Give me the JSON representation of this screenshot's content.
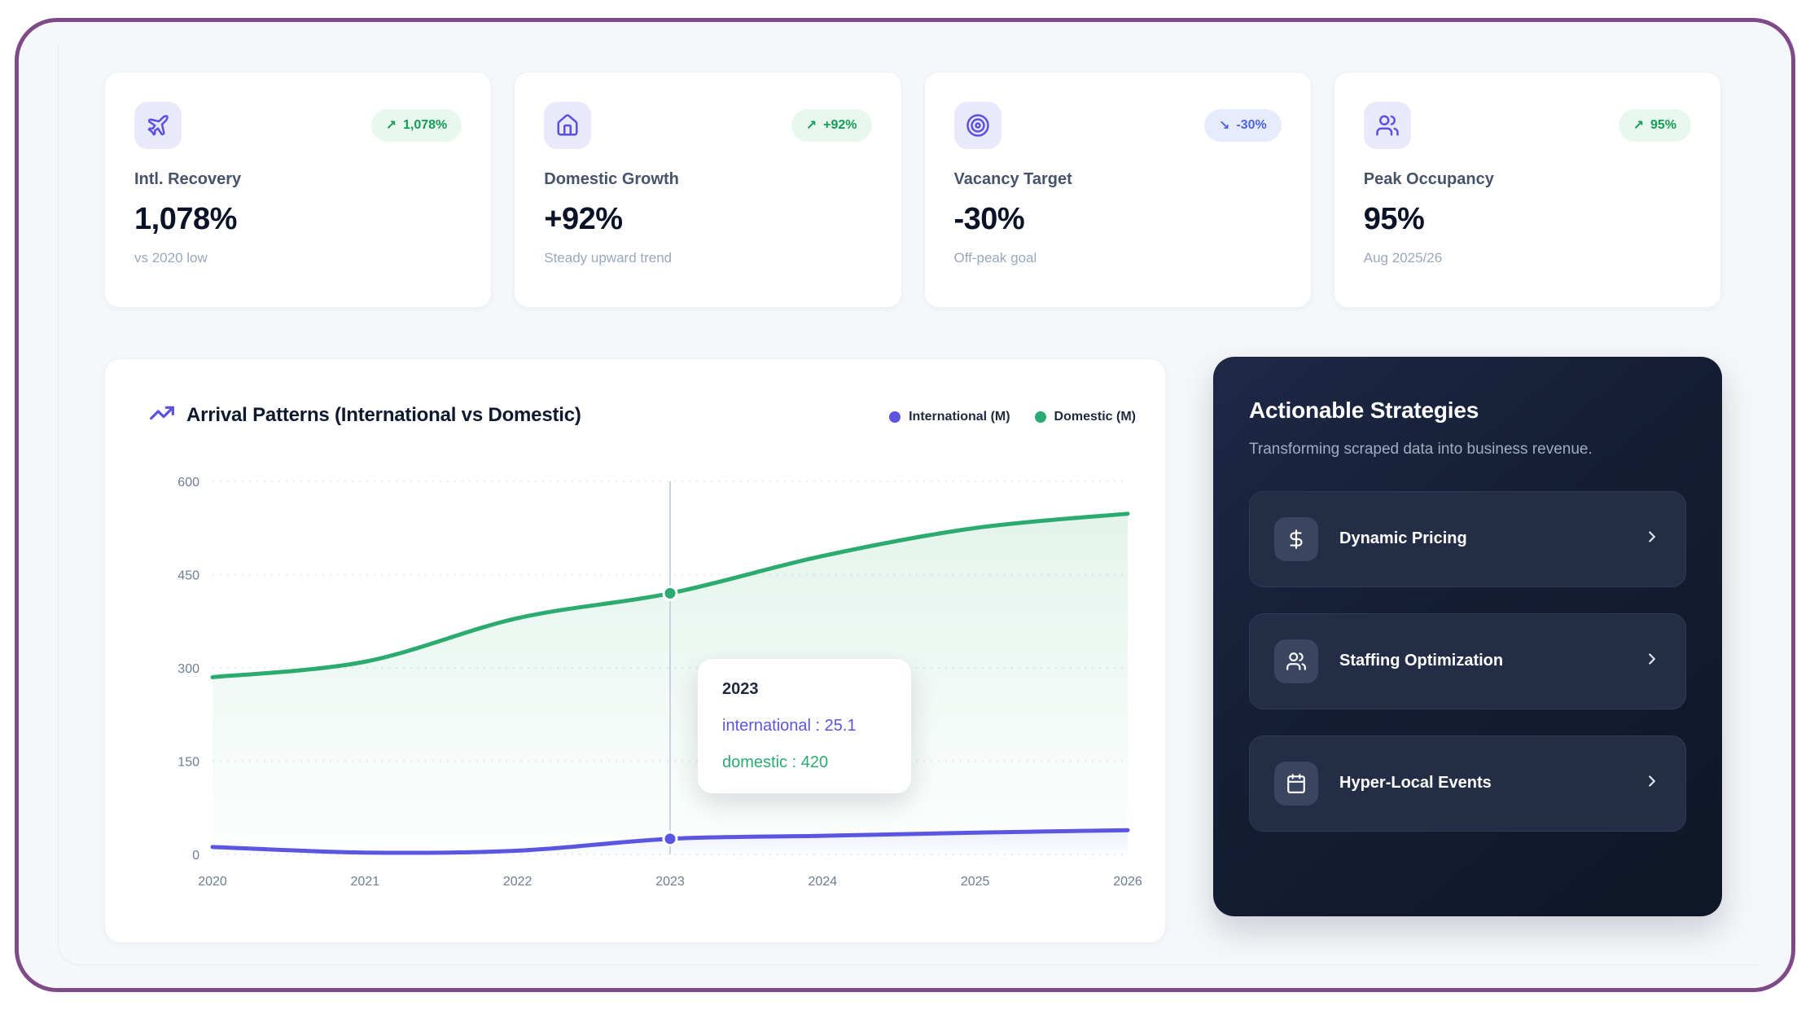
{
  "frame": {
    "border_color": "#7e4b88",
    "background": "#f5f7fa"
  },
  "stat_cards": [
    {
      "label": "Intl. Recovery",
      "value": "1,078%",
      "subtitle": "vs 2020 low",
      "badge_text": "1,078%",
      "badge_arrow": "↗",
      "badge_color": "green",
      "icon": "plane-icon"
    },
    {
      "label": "Domestic Growth",
      "value": "+92%",
      "subtitle": "Steady upward trend",
      "badge_text": "+92%",
      "badge_arrow": "↗",
      "badge_color": "green",
      "icon": "home-icon"
    },
    {
      "label": "Vacancy Target",
      "value": "-30%",
      "subtitle": "Off-peak goal",
      "badge_text": "-30%",
      "badge_arrow": "↘",
      "badge_color": "blue",
      "icon": "target-icon"
    },
    {
      "label": "Peak Occupancy",
      "value": "95%",
      "subtitle": "Aug 2025/26",
      "badge_text": "95%",
      "badge_arrow": "↗",
      "badge_color": "green",
      "icon": "users-icon"
    }
  ],
  "chart_card": {
    "title": "Arrival Patterns (International vs Domestic)",
    "legend": [
      {
        "label": "International (M)"
      },
      {
        "label": "Domestic (M)"
      }
    ]
  },
  "chart_data": {
    "type": "area",
    "title": "Arrival Patterns (International vs Domestic)",
    "x": [
      2020,
      2021,
      2022,
      2023,
      2024,
      2025,
      2026
    ],
    "series": [
      {
        "name": "International (M)",
        "color": "#5b55e3",
        "fill_opacity": 0.09,
        "values": [
          12,
          3,
          6,
          25.1,
          30,
          35,
          39
        ]
      },
      {
        "name": "Domestic (M)",
        "color": "#2bab70",
        "fill_opacity": 0.13,
        "values": [
          285,
          310,
          380,
          420,
          480,
          525,
          548
        ]
      }
    ],
    "ylim": [
      0,
      600
    ],
    "yticks": [
      0,
      150,
      300,
      450,
      600
    ],
    "grid": "horizontal dotted",
    "legend_position": "top-right",
    "hover": {
      "index": 3,
      "label": "2023"
    }
  },
  "tooltip": {
    "title": "2023",
    "rows": [
      {
        "text": "international : 25.1"
      },
      {
        "text": "domestic : 420"
      }
    ]
  },
  "strategies": {
    "title": "Actionable Strategies",
    "subtitle": "Transforming scraped data into business revenue.",
    "items": [
      {
        "label": "Dynamic Pricing",
        "icon": "dollar-icon"
      },
      {
        "label": "Staffing Optimization",
        "icon": "users-icon"
      },
      {
        "label": "Hyper-Local Events",
        "icon": "calendar-icon"
      }
    ]
  }
}
